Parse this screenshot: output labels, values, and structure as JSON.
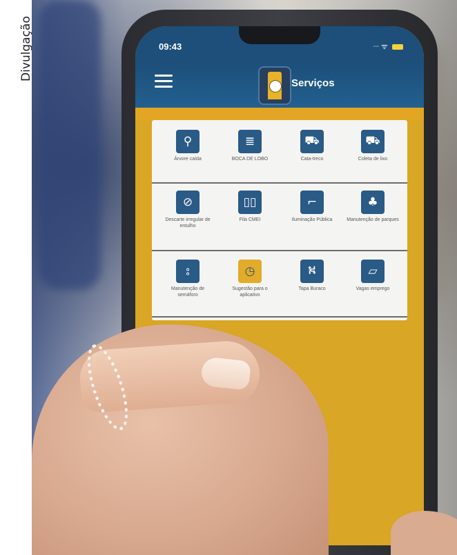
{
  "credit": "Divulgação",
  "status": {
    "time": "09:43",
    "signal": "ᐧᐧᐧ ᯤ"
  },
  "app": {
    "title": "Serviços"
  },
  "services": [
    {
      "label": "Árvore caída",
      "icon": "tree-search-icon",
      "glyph": "⚲"
    },
    {
      "label": "BOCA DE LOBO",
      "icon": "drain-icon",
      "glyph": "≣"
    },
    {
      "label": "Cata-treco",
      "icon": "truck-icon",
      "glyph": "⛟"
    },
    {
      "label": "Coleta de lixo",
      "icon": "garbage-truck-icon",
      "glyph": "⛟"
    },
    {
      "label": "Descarte irregular de entulho",
      "icon": "no-dumping-icon",
      "glyph": "⊘"
    },
    {
      "label": "Fila CMEI",
      "icon": "book-icon",
      "glyph": "▯▯"
    },
    {
      "label": "Iluminação Pública",
      "icon": "street-light-icon",
      "glyph": "⌐"
    },
    {
      "label": "Manutenção de parques",
      "icon": "park-tree-icon",
      "glyph": "♣"
    },
    {
      "label": "Manutenção de semáforo",
      "icon": "traffic-light-icon",
      "glyph": "⦂"
    },
    {
      "label": "Sugestão para o aplicativo",
      "icon": "app-logo-icon",
      "glyph": "◷"
    },
    {
      "label": "Tapa Buraco",
      "icon": "pothole-icon",
      "glyph": "⛕"
    },
    {
      "label": "Vagas emprego",
      "icon": "job-sign-icon",
      "glyph": "▱"
    }
  ]
}
